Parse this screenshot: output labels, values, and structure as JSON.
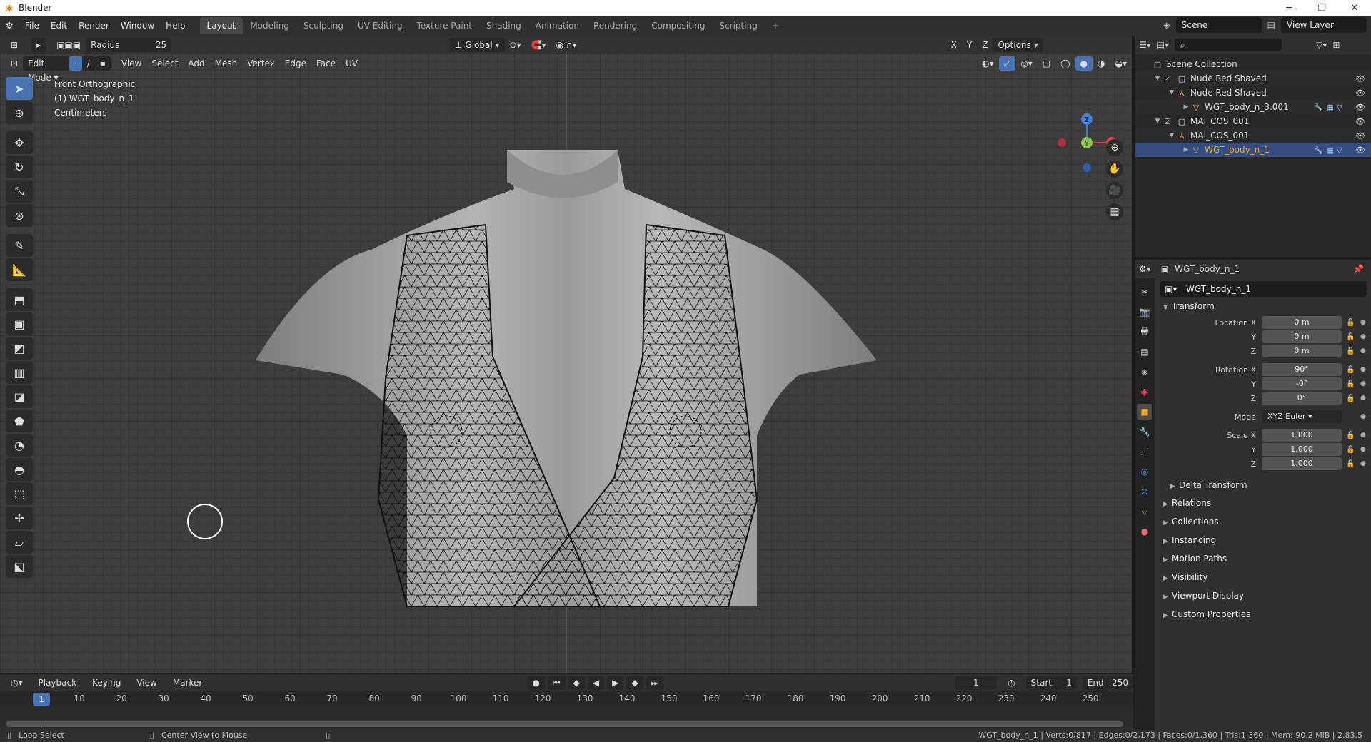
{
  "window": {
    "app_title": "Blender",
    "minimize": "─",
    "maximize": "❐",
    "close": "✕"
  },
  "menu": [
    "File",
    "Edit",
    "Render",
    "Window",
    "Help"
  ],
  "workspaces": {
    "tabs": [
      "Layout",
      "Modeling",
      "Sculpting",
      "UV Editing",
      "Texture Paint",
      "Shading",
      "Animation",
      "Rendering",
      "Compositing",
      "Scripting"
    ],
    "active": "Layout",
    "add": "+"
  },
  "topbar": {
    "scene": "Scene",
    "view_layer": "View Layer"
  },
  "viewport": {
    "radius_label": "Radius",
    "radius_value": "25",
    "orientation": "Global",
    "options": "Options",
    "mode": "Edit Mode",
    "header_menu": [
      "View",
      "Select",
      "Add",
      "Mesh",
      "Vertex",
      "Edge",
      "Face",
      "UV"
    ],
    "view_name": "Front Orthographic",
    "object_info": "(1) WGT_body_n_1",
    "units": "Centimeters",
    "axes": [
      "X",
      "Y",
      "Z"
    ],
    "gizmo_labels": {
      "z": "Z",
      "y": "Y",
      "x": "X"
    }
  },
  "timeline": {
    "menu": [
      "Playback",
      "Keying",
      "View",
      "Marker"
    ],
    "current_frame": "1",
    "start_label": "Start",
    "start": "1",
    "end_label": "End",
    "end": "250",
    "ticks": [
      "10",
      "20",
      "30",
      "40",
      "50",
      "60",
      "70",
      "80",
      "90",
      "100",
      "110",
      "120",
      "130",
      "140",
      "150",
      "160",
      "170",
      "180",
      "190",
      "200",
      "210",
      "220",
      "230",
      "240",
      "250"
    ]
  },
  "statusbar": {
    "left_action": "Loop Select",
    "mid_action": "Center View to Mouse",
    "stats": "WGT_body_n_1 | Verts:0/817 | Edges:0/2,173 | Faces:0/1,360 | Tris:1,360 | Mem: 90.2 MiB | 2.83.5"
  },
  "outliner": {
    "root": "Scene Collection",
    "rows": [
      {
        "label": "Nude Red Shaved",
        "type": "collection"
      },
      {
        "label": "Nude Red Shaved",
        "type": "armature"
      },
      {
        "label": "WGT_body_n_3.001",
        "type": "mesh"
      },
      {
        "label": "MAI_COS_001",
        "type": "collection"
      },
      {
        "label": "MAI_COS_001",
        "type": "armature"
      },
      {
        "label": "WGT_body_n_1",
        "type": "mesh"
      }
    ]
  },
  "properties": {
    "header_object": "WGT_body_n_1",
    "object_name": "WGT_body_n_1",
    "transform_title": "Transform",
    "location": {
      "label": "Location X",
      "x": "0 m",
      "y": "0 m",
      "z": "0 m"
    },
    "rotation": {
      "label": "Rotation X",
      "x": "90°",
      "y": "-0°",
      "z": "0°"
    },
    "mode_label": "Mode",
    "mode_value": "XYZ Euler",
    "scale": {
      "label": "Scale X",
      "x": "1.000",
      "y": "1.000",
      "z": "1.000"
    },
    "axis_y": "Y",
    "axis_z": "Z",
    "delta_transform": "Delta Transform",
    "sections": [
      "Relations",
      "Collections",
      "Instancing",
      "Motion Paths",
      "Visibility",
      "Viewport Display",
      "Custom Properties"
    ]
  },
  "colors": {
    "accent": "#4772b3",
    "selected_text": "#f5a623",
    "x_axis": "#e0434f",
    "y_axis": "#8bc34a",
    "z_axis": "#3b7fe0",
    "mesh": "#9c9c9c"
  }
}
